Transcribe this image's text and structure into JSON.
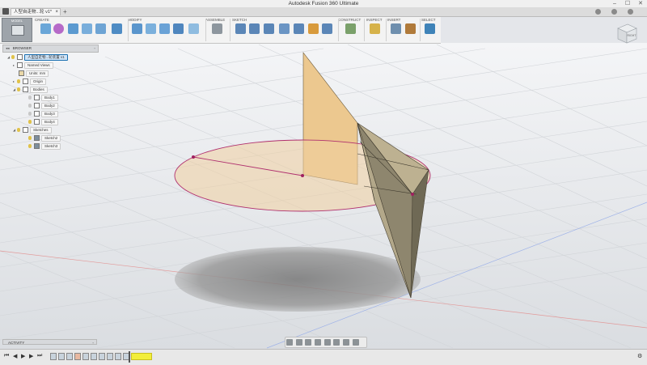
{
  "window": {
    "title": "Autodesk Fusion 360 Ultimate",
    "controls": [
      "–",
      "☐",
      "✕"
    ]
  },
  "tabs": [
    {
      "label": "人型自走物...轮 v1*",
      "close": "×"
    }
  ],
  "new_tab": "+",
  "ribbon": {
    "workspace": "MODEL",
    "groups": [
      "CREATE",
      "MODIFY",
      "ASSEMBLE",
      "SKETCH",
      "CONSTRUCT",
      "INSPECT",
      "INSERT",
      "SELECT"
    ]
  },
  "viewcube": {
    "label": "RIGHT"
  },
  "browser": {
    "header": "BROWSER",
    "root": "人型自走物...轮装置 v1",
    "items": [
      {
        "label": "Named Views"
      },
      {
        "label": "Units: mm"
      },
      {
        "label": "Origin"
      },
      {
        "label": "Bodies"
      },
      {
        "label": "Body1"
      },
      {
        "label": "Body2"
      },
      {
        "label": "Body3"
      },
      {
        "label": "Body4"
      },
      {
        "label": "Sketches"
      },
      {
        "label": "Sketch2"
      },
      {
        "label": "Sketch3"
      }
    ]
  },
  "activity": {
    "label": "ACTIVITY"
  },
  "colors": {
    "accent": "#1a6fb0",
    "sketch_line": "#b0306e",
    "body_face": "#e6c38a",
    "cone_face": "#8e866e",
    "grid": "#d3d6da"
  }
}
